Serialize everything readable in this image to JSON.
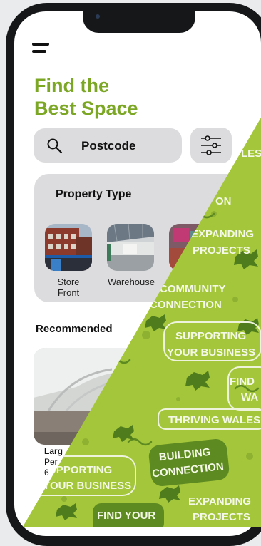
{
  "header": {
    "title_line1": "Find the",
    "title_line2": "Best Space"
  },
  "search": {
    "label": "Postcode"
  },
  "property_type": {
    "heading": "Property Type",
    "items": [
      {
        "label_line1": "Store",
        "label_line2": "Front"
      },
      {
        "label_line1": "Warehouse",
        "label_line2": ""
      }
    ]
  },
  "recommended": {
    "heading": "Recommended",
    "card": {
      "title": "Larg",
      "line2": "Per",
      "line3": "6"
    }
  },
  "banner_phrases": [
    "EXPANDING",
    "PROJECTS",
    "SUPPORTING",
    "YOUR BUSINESS",
    "THRIVING WALES",
    "BUILDING",
    "CONNECTION",
    "FIND YOUR",
    "COMMUNITY",
    "FIND",
    "WA",
    "ON",
    "LES"
  ],
  "colors": {
    "accent": "#7ba724",
    "pattern_bg": "#a3c63b",
    "pattern_dark": "#5e8a22"
  }
}
